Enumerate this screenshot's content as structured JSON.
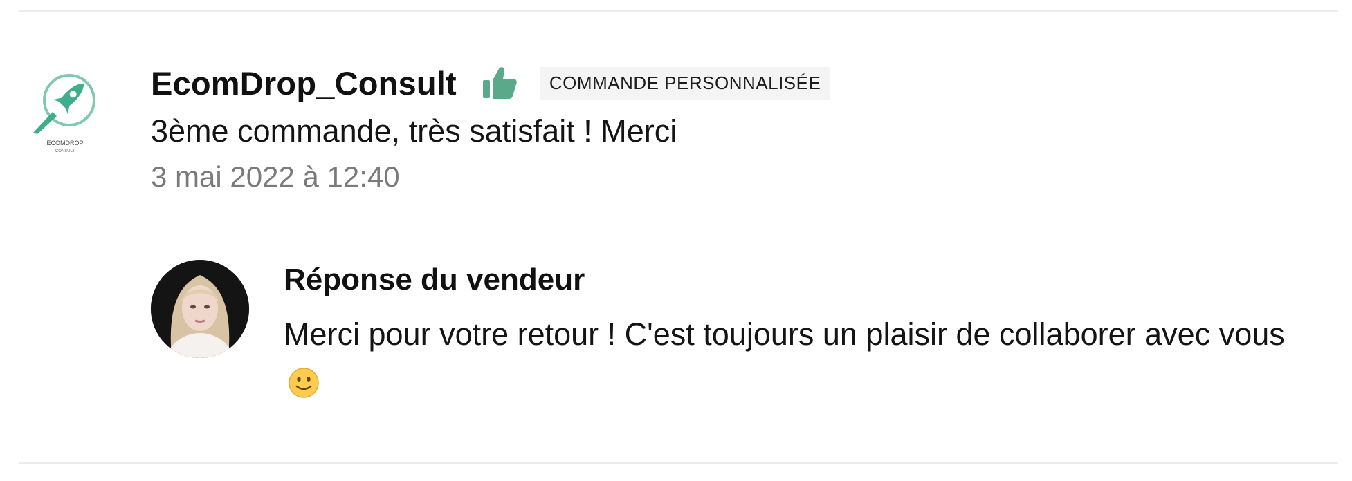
{
  "review": {
    "username": "EcomDrop_Consult",
    "avatar_icon": "rocket-logo-icon",
    "logo_text": "ECOMDROP",
    "logo_subtext": "CONSULT",
    "rating_icon": "thumbs-up-icon",
    "rating_color": "#5aa98a",
    "tag": "COMMANDE PERSONNALISÉE",
    "text": "3ème commande, très satisfait ! Merci",
    "date": "3 mai 2022 à 12:40"
  },
  "reply": {
    "title": "Réponse du vendeur",
    "text": "Merci pour votre retour ! C'est toujours un plaisir de collaborer avec vous",
    "emoji_icon": "slightly-smiling-face-icon",
    "avatar_icon": "seller-avatar-photo"
  },
  "colors": {
    "accent_green": "#5aa98a",
    "date_gray": "#7a7a7a",
    "badge_bg": "#f4f4f4",
    "divider": "#ececec"
  }
}
